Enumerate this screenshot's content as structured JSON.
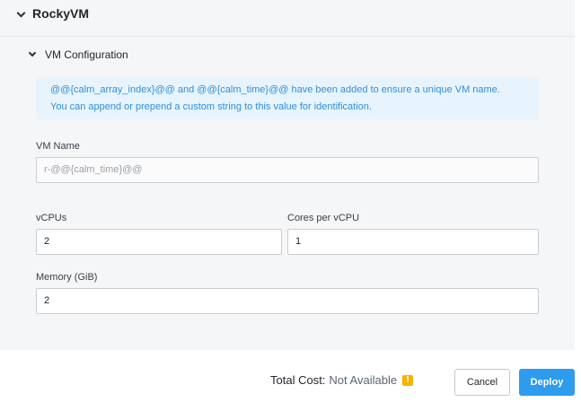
{
  "section": {
    "title": "RockyVM"
  },
  "vm_config": {
    "title": "VM Configuration",
    "info_line1": "@@{calm_array_index}@@ and @@{calm_time}@@ have been added to ensure a unique VM name.",
    "info_line2": "You can append or prepend a custom string to this value for identification.",
    "vm_name_label": "VM Name",
    "vm_name_value": "r-@@{calm_time}@@",
    "vcpus_label": "vCPUs",
    "vcpus_value": "2",
    "cores_label": "Cores per vCPU",
    "cores_value": "1",
    "memory_label": "Memory (GiB)",
    "memory_value": "2"
  },
  "footer": {
    "total_cost_label": "Total Cost:",
    "total_cost_value": "Not Available",
    "warning_glyph": "!",
    "cancel_label": "Cancel",
    "deploy_label": "Deploy"
  },
  "colors": {
    "accent": "#2d9cee",
    "info_text": "#2d8fde",
    "info_bg": "#e8f4fd",
    "warning": "#f5b400"
  }
}
